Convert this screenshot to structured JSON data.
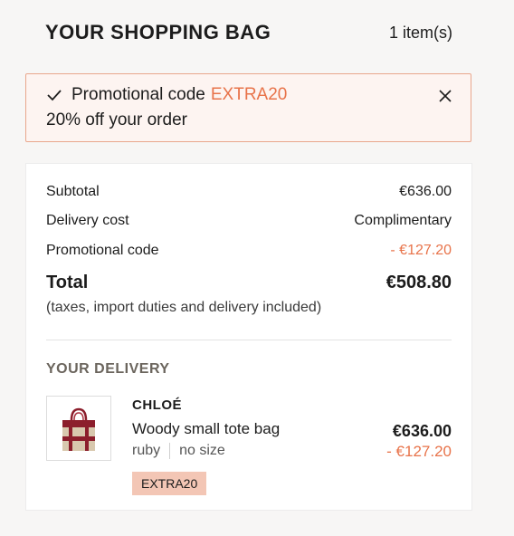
{
  "header": {
    "title": "YOUR SHOPPING BAG",
    "item_count": "1 item(s)"
  },
  "promo_banner": {
    "label": "Promotional code",
    "code": "EXTRA20",
    "description": "20% off your order",
    "icons": {
      "check": "check-icon",
      "close": "close-icon"
    }
  },
  "summary": {
    "subtotal_label": "Subtotal",
    "subtotal_value": "€636.00",
    "delivery_label": "Delivery cost",
    "delivery_value": "Complimentary",
    "promo_label": "Promotional code",
    "promo_value": "- €127.20",
    "total_label": "Total",
    "total_value": "€508.80",
    "tax_note": "(taxes, import duties and delivery included)"
  },
  "delivery": {
    "title": "YOUR DELIVERY",
    "item": {
      "brand": "CHLOÉ",
      "name": "Woody small tote bag",
      "color": "ruby",
      "size": "no size",
      "price": "€636.00",
      "discount": "- €127.20",
      "promo_tag": "EXTRA20"
    }
  },
  "colors": {
    "accent": "#e8734a",
    "banner_bg": "#fdf4f1",
    "banner_border": "#e9a78d",
    "tag_bg": "#f3c6b5"
  }
}
